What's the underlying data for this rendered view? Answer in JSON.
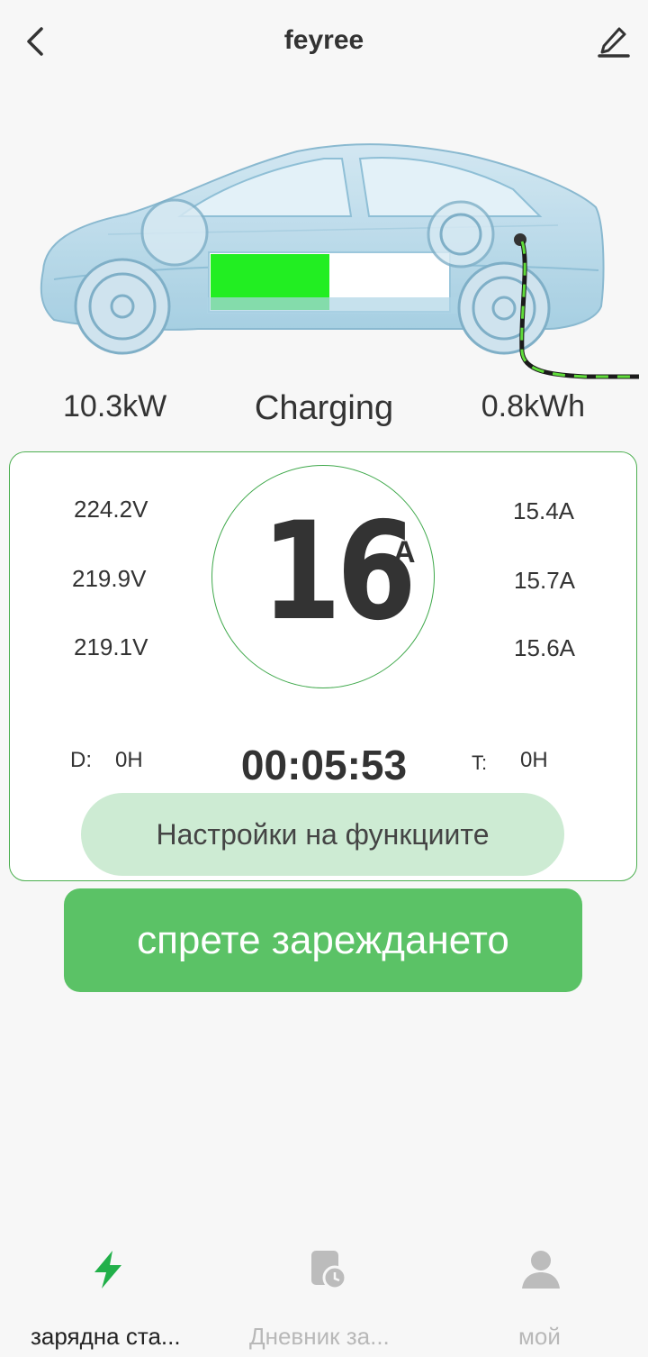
{
  "header": {
    "title": "feyree",
    "back_icon": "chevron-left-icon",
    "edit_icon": "pencil-icon"
  },
  "car": {
    "battery_level_fraction": 0.5,
    "battery_fill_color": "#22ee22"
  },
  "stats": {
    "power": "10.3kW",
    "status": "Charging",
    "energy": "0.8kWh"
  },
  "panel": {
    "voltages": [
      "224.2V",
      "219.9V",
      "219.1V"
    ],
    "currents": [
      "15.4A",
      "15.7A",
      "15.6A"
    ],
    "set_current": "16",
    "set_current_unit": "A",
    "delay_label": "D:",
    "delay_value": "0H",
    "timer_label": "T:",
    "timer_value": "0H",
    "elapsed": "00:05:53",
    "function_settings_label": "Настройки на функциите"
  },
  "actions": {
    "stop_label": "спрете зареждането"
  },
  "bottom_nav": {
    "items": [
      {
        "label": "зарядна ста...",
        "icon": "lightning-icon",
        "active": true
      },
      {
        "label": "Дневник за...",
        "icon": "log-clock-icon",
        "active": false
      },
      {
        "label": "мой",
        "icon": "user-icon",
        "active": false
      }
    ]
  },
  "colors": {
    "accent": "#5bc266",
    "accent_light": "#cdebd3",
    "border": "#4caf50"
  }
}
